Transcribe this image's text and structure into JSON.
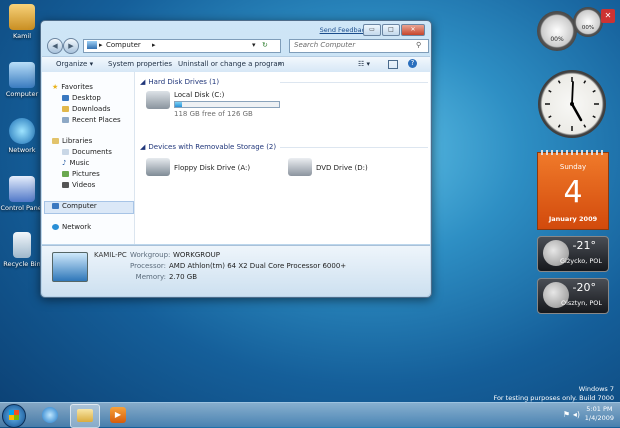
{
  "desktop": {
    "icons": [
      {
        "label": "Kamil",
        "icon": "user-folder-icon"
      },
      {
        "label": "Computer",
        "icon": "computer-icon"
      },
      {
        "label": "Network",
        "icon": "network-icon"
      },
      {
        "label": "Control Panel",
        "icon": "control-panel-icon"
      },
      {
        "label": "Recycle Bin",
        "icon": "recycle-bin-icon"
      }
    ]
  },
  "window": {
    "feedback": "Send Feedback",
    "buttons": {
      "min": "▭",
      "max": "□",
      "close": "✕"
    },
    "address": {
      "root": "Computer"
    },
    "search_placeholder": "Search Computer",
    "toolbar": {
      "organize": "Organize ▾",
      "system_properties": "System properties",
      "uninstall": "Uninstall or change a program",
      "more": "»"
    },
    "nav": {
      "favorites": "Favorites",
      "desktop": "Desktop",
      "downloads": "Downloads",
      "recent": "Recent Places",
      "libraries": "Libraries",
      "documents": "Documents",
      "music": "Music",
      "pictures": "Pictures",
      "videos": "Videos",
      "computer": "Computer",
      "network": "Network"
    },
    "groups": {
      "hdd": "Hard Disk Drives (1)",
      "removable": "Devices with Removable Storage (2)"
    },
    "drives": {
      "local": {
        "name": "Local Disk (C:)",
        "free": "118 GB free of 126 GB",
        "used_fraction": 0.063
      },
      "floppy": "Floppy Disk Drive (A:)",
      "dvd": "DVD Drive (D:)"
    },
    "details": {
      "pc_name": "KAMIL-PC",
      "workgroup_label": "Workgroup:",
      "workgroup": "WORKGROUP",
      "processor_label": "Processor:",
      "processor": "AMD Athlon(tm) 64 X2 Dual Core Processor 6000+",
      "memory_label": "Memory:",
      "memory": "2.70 GB"
    }
  },
  "gadgets": {
    "cpu_percent": "00%",
    "mem_percent": "00%",
    "calendar": {
      "weekday": "Sunday",
      "day": "4",
      "month_year": "January 2009"
    },
    "weather": [
      {
        "temp": "-21°",
        "city": "Giżycko, POL"
      },
      {
        "temp": "-20°",
        "city": "Olsztyn, POL"
      }
    ]
  },
  "watermark": {
    "line1": "Windows 7",
    "line2": "For testing purposes only. Build 7000"
  },
  "taskbar": {
    "time": "5:01 PM",
    "date": "1/4/2009"
  }
}
